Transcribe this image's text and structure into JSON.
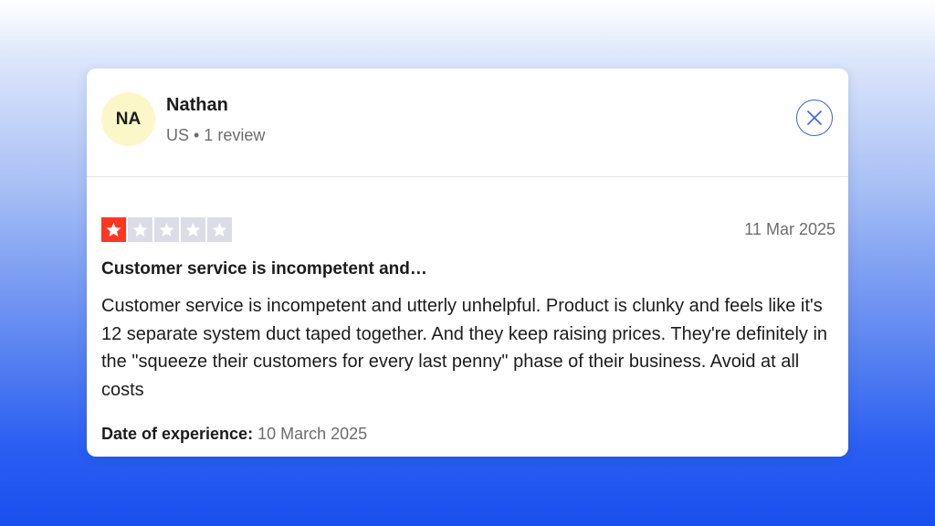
{
  "reviewer": {
    "initials": "NA",
    "name": "Nathan",
    "meta": "US • 1 review",
    "avatar_color": "#fcf7c9"
  },
  "close_icon": "close-x-icon",
  "review": {
    "rating": 1,
    "max_rating": 5,
    "star_active_color": "#ff3722",
    "star_inactive_color": "#dcdce6",
    "date": "11 Mar 2025",
    "title": "Customer service is incompetent and…",
    "body": "Customer service is incompetent and utterly unhelpful. Product is clunky and feels like it's 12 separate system duct taped together. And they keep raising prices. They're definitely in the \"squeeze their customers for every last penny\" phase of their business. Avoid at all costs",
    "experience_label": "Date of experience:",
    "experience_date": "10 March 2025"
  }
}
